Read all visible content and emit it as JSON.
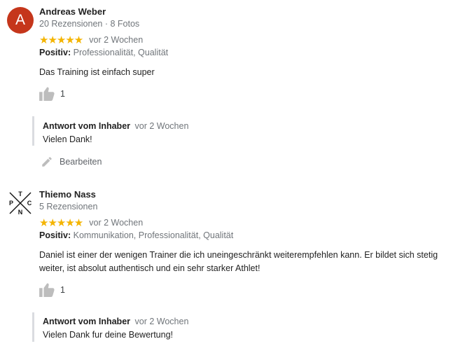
{
  "reviews": [
    {
      "avatar_letter": "A",
      "avatar_color": "#c5361b",
      "name": "Andreas Weber",
      "meta": "20 Rezensionen · 8 Fotos",
      "stars": 5,
      "star_glyphs": "★★★★★",
      "date": "vor 2 Wochen",
      "positive_label": "Positiv:",
      "positive_values": "Professionalität, Qualität",
      "text": "Das Training ist einfach super",
      "likes": "1",
      "reply": {
        "label": "Antwort vom Inhaber",
        "date": "vor 2 Wochen",
        "text": "Vielen Dank!"
      },
      "edit_label": "Bearbeiten"
    },
    {
      "avatar_logo_letters": {
        "top": "T",
        "left": "P",
        "right": "C",
        "bottom": "N"
      },
      "name": "Thiemo Nass",
      "meta": "5 Rezensionen",
      "stars": 5,
      "star_glyphs": "★★★★★",
      "date": "vor 2 Wochen",
      "positive_label": "Positiv:",
      "positive_values": "Kommunikation, Professionalität, Qualität",
      "text": "Daniel ist einer der wenigen Trainer die ich uneingeschränkt weiterempfehlen kann. Er bildet sich stetig weiter, ist absolut authentisch und ein sehr starker Athlet!",
      "likes": "1",
      "reply": {
        "label": "Antwort vom Inhaber",
        "date": "vor 2 Wochen",
        "text": "Vielen Dank fur deine Bewertung!"
      }
    }
  ],
  "colors": {
    "star": "#f4b400",
    "secondary_text": "#70757a",
    "reply_border": "#dadce0",
    "icon": "#bdbdbd"
  },
  "icons": [
    "thumbs-up-icon",
    "pencil-icon"
  ]
}
